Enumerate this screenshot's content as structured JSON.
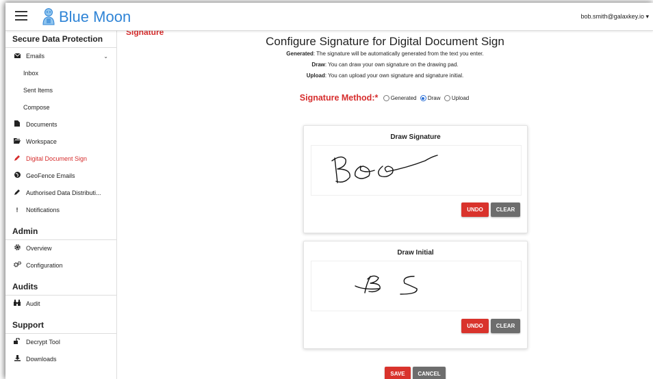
{
  "app": {
    "brand": "Blue Moon",
    "user": "bob.smith@galaxkey.io",
    "user_caret": "▾"
  },
  "sidebar": {
    "sections": [
      {
        "title": "Secure Data Protection"
      },
      {
        "title": "Admin"
      },
      {
        "title": "Audits"
      },
      {
        "title": "Support"
      }
    ],
    "items": {
      "emails": "Emails",
      "inbox": "Inbox",
      "sent": "Sent Items",
      "compose": "Compose",
      "documents": "Documents",
      "workspace": "Workspace",
      "digital_sign": "Digital Document Sign",
      "geofence": "GeoFence Emails",
      "authorised": "Authorised Data Distributi...",
      "notifications": "Notifications",
      "overview": "Overview",
      "configuration": "Configuration",
      "audit": "Audit",
      "decrypt": "Decrypt Tool",
      "downloads": "Downloads"
    },
    "active_item": "Digital Document Sign",
    "icons": {
      "emails": "envelope-icon",
      "documents": "file-icon",
      "workspace": "folder-open-icon",
      "digital_sign": "pencil-icon",
      "geofence": "globe-icon",
      "authorised": "pencil-icon",
      "notifications": "exclamation-icon",
      "overview": "gear-icon",
      "configuration": "gears-icon",
      "audit": "binoculars-icon",
      "decrypt": "unlock-icon",
      "downloads": "download-icon"
    }
  },
  "main": {
    "breadcrumb": "Signature",
    "title": "Configure Signature for Digital Document Sign",
    "descriptions": [
      {
        "label": "Generated",
        "text": ": The signature will be automatically generated from the text you enter."
      },
      {
        "label": "Draw",
        "text": ": You can draw your own signature on the drawing pad."
      },
      {
        "label": "Upload",
        "text": ": You can upload your own signature and signature initial."
      }
    ],
    "method": {
      "label": "Signature Method:*",
      "options": [
        "Generated",
        "Draw",
        "Upload"
      ],
      "selected": "Draw"
    },
    "signature_card": {
      "title": "Draw Signature",
      "undo": "UNDO",
      "clear": "CLEAR"
    },
    "initial_card": {
      "title": "Draw Initial",
      "undo": "UNDO",
      "clear": "CLEAR"
    },
    "save": "SAVE",
    "cancel": "CANCEL"
  },
  "colors": {
    "brand": "#2f84d6",
    "accent_red": "#d62d2d",
    "button_red": "#d9332c",
    "button_gray": "#6d6d6d",
    "radio_selected": "#2a6fd6"
  }
}
